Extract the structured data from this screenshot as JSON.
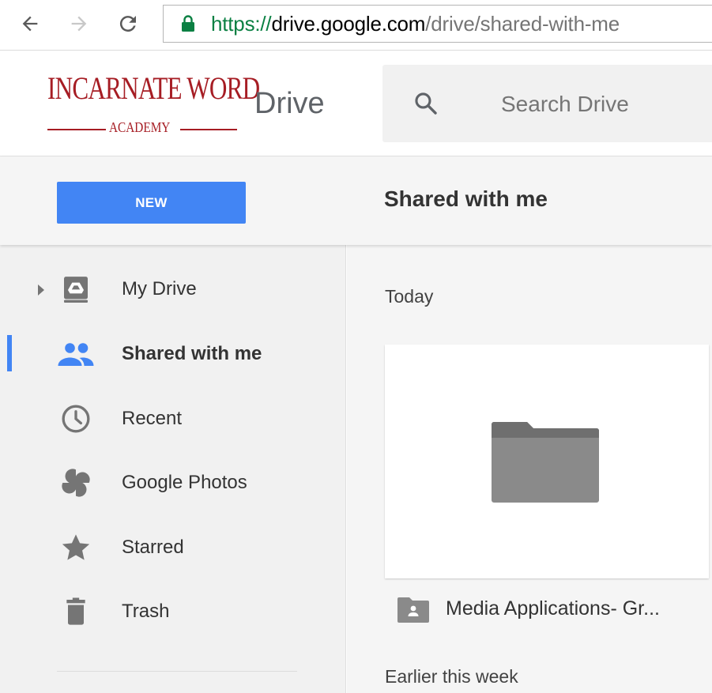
{
  "browser": {
    "url_scheme": "https://",
    "url_host": "drive.google.com",
    "url_path": "/drive/shared-with-me",
    "icons": [
      "back-arrow-icon",
      "forward-arrow-icon",
      "reload-icon",
      "lock-icon"
    ]
  },
  "header": {
    "logo_main": "INCARNATE WORD",
    "logo_sub": "ACADEMY",
    "app_name": "Drive",
    "search_placeholder": "Search Drive"
  },
  "toolbar": {
    "new_label": "NEW",
    "section_title": "Shared with me"
  },
  "sidebar": {
    "items": [
      {
        "label": "My Drive",
        "icon": "my-drive-icon"
      },
      {
        "label": "Shared with me",
        "icon": "people-icon",
        "active": true
      },
      {
        "label": "Recent",
        "icon": "clock-icon"
      },
      {
        "label": "Google Photos",
        "icon": "pinwheel-icon"
      },
      {
        "label": "Starred",
        "icon": "star-icon"
      },
      {
        "label": "Trash",
        "icon": "trash-icon"
      }
    ]
  },
  "main": {
    "groups": [
      {
        "label": "Today"
      },
      {
        "label": "Earlier this week"
      }
    ],
    "items": [
      {
        "name": "Media Applications- Gr...",
        "type": "shared-folder"
      }
    ]
  },
  "colors": {
    "accent": "#4285f4",
    "logo": "#a61d24",
    "secure": "#0b8043"
  }
}
